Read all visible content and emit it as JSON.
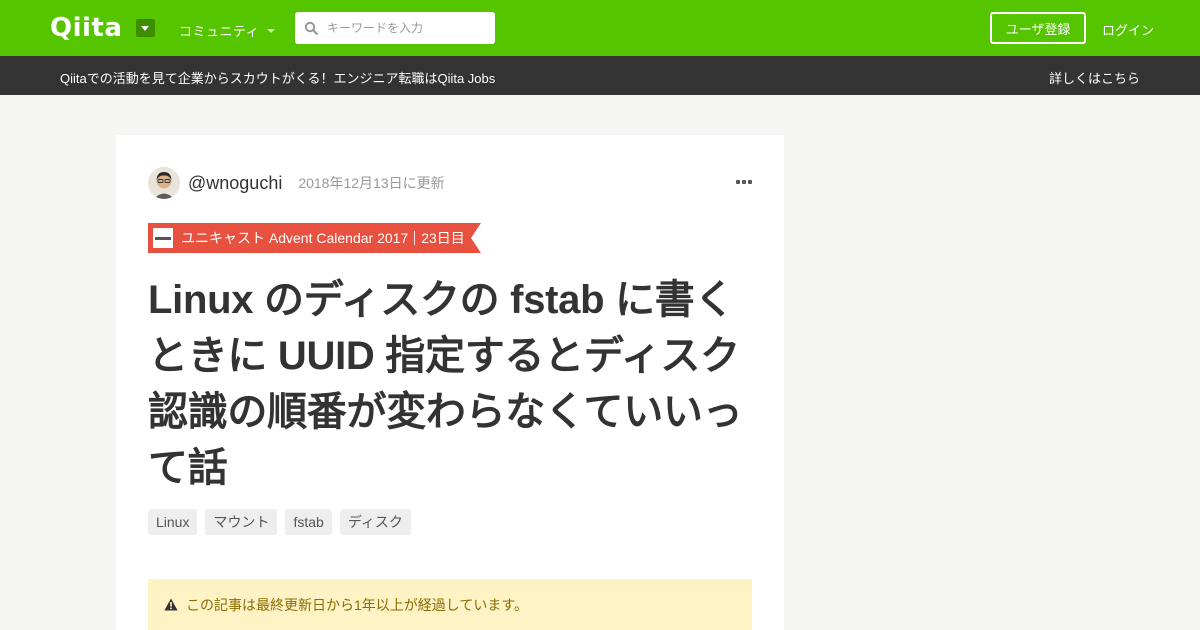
{
  "header": {
    "logo_text": "Qiita",
    "community_label": "コミュニティ",
    "search_placeholder": "キーワードを入力",
    "signup_label": "ユーザ登録",
    "login_label": "ログイン",
    "brand_color": "#55c500"
  },
  "banner": {
    "text": "Qiitaでの活動を見て企業からスカウトがくる！エンジニア転職はQiita Jobs",
    "link_label": "詳しくはこちら"
  },
  "article": {
    "author": "@wnoguchi",
    "updated": "2018年12月13日に更新",
    "advent_calendar": {
      "name": "ユニキャスト Advent Calendar 2017",
      "day": "23日目",
      "color": "#e8513f"
    },
    "title": "Linux のディスクの fstab に書くときに UUID 指定するとディスク認識の順番が変わらなくていいって話",
    "tags": [
      "Linux",
      "マウント",
      "fstab",
      "ディスク"
    ],
    "notice": "この記事は最終更新日から1年以上が経過しています。"
  },
  "icons": {
    "search": "search-icon",
    "more": "more-options-icon",
    "warning": "warning-icon",
    "dropdown": "chevron-down-icon"
  }
}
